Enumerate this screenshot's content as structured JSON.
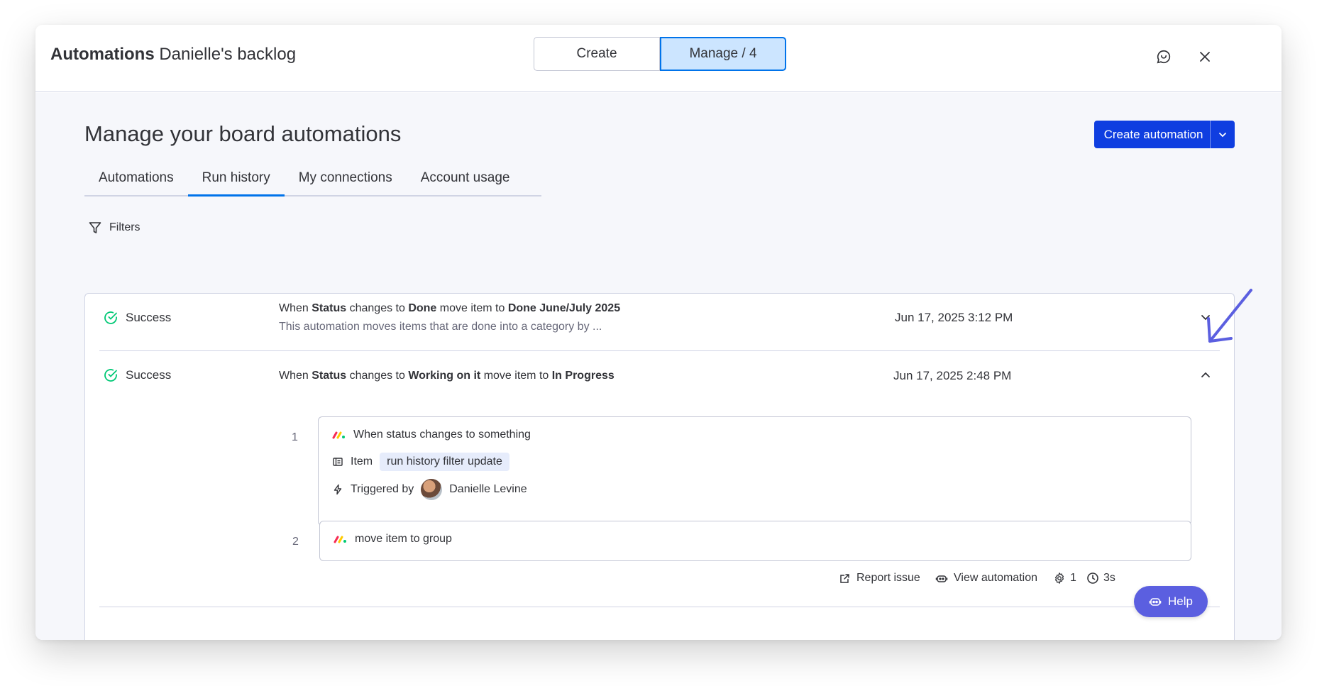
{
  "header": {
    "title_bold": "Automations",
    "title_rest": "Danielle's backlog",
    "segments": [
      "Create",
      "Manage / 4"
    ],
    "active_segment": "Manage / 4"
  },
  "page": {
    "title": "Manage your board automations",
    "create_button": "Create automation"
  },
  "tabs": [
    {
      "label": "Automations",
      "active": false
    },
    {
      "label": "Run history",
      "active": true
    },
    {
      "label": "My connections",
      "active": false
    },
    {
      "label": "Account usage",
      "active": false
    }
  ],
  "filters_label": "Filters",
  "runs": [
    {
      "status": "Success",
      "parts": {
        "p1": "When ",
        "b1": "Status",
        "p2": " changes to ",
        "b2": "Done",
        "p3": "  move item to ",
        "b3": "Done June/July 2025"
      },
      "subtitle": "This automation moves items that are done into a category by ...",
      "date": "Jun 17, 2025 3:12 PM",
      "expanded": false
    },
    {
      "status": "Success",
      "parts": {
        "p1": "When ",
        "b1": "Status",
        "p2": " changes to ",
        "b2": "Working on it",
        "p3": "  move item to ",
        "b3": "In Progress"
      },
      "date": "Jun 17, 2025 2:48 PM",
      "expanded": true,
      "steps": [
        {
          "number": "1",
          "title": "When status changes to something",
          "item_label": "Item",
          "item_value": "run history filter update",
          "triggered_label": "Triggered by",
          "triggered_user": "Danielle Levine"
        },
        {
          "number": "2",
          "title": "move item to group"
        }
      ],
      "actions": {
        "report": "Report issue",
        "view": "View automation",
        "actions_count": "1",
        "duration": "3s"
      }
    }
  ],
  "help_label": "Help",
  "colors": {
    "accent": "#0073ea",
    "primary_button": "#0f3ee0",
    "success": "#00c875",
    "help": "#5b5fe0",
    "annotation_arrow": "#5b5fe0"
  }
}
